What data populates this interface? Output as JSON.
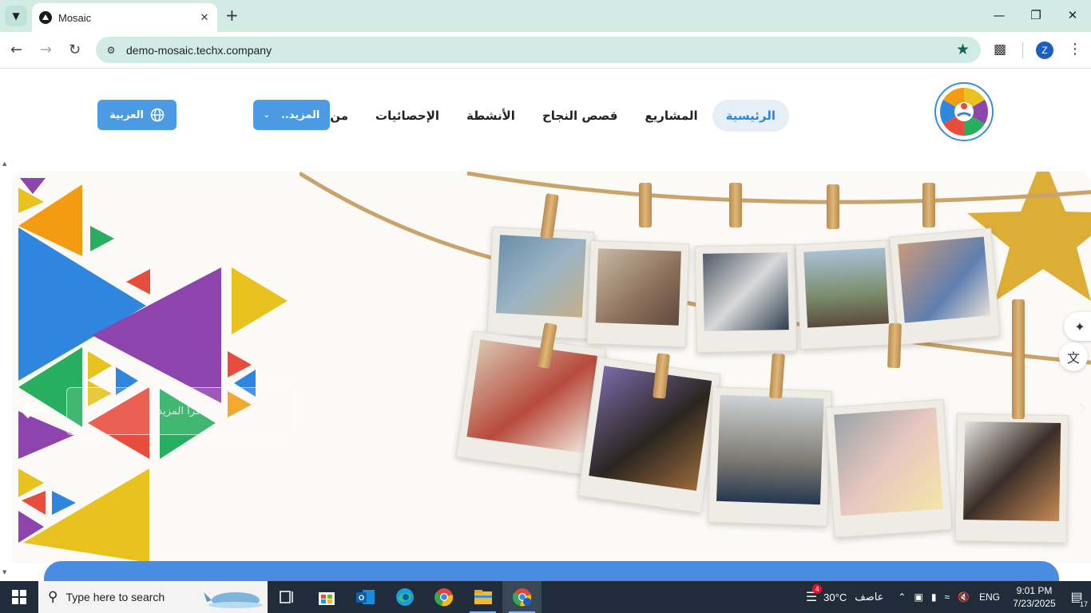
{
  "browser": {
    "tab_title": "Mosaic",
    "url": "demo-mosaic.techx.company",
    "profile_initial": "Z"
  },
  "site": {
    "nav": [
      {
        "label": "الرئيسية",
        "active": true
      },
      {
        "label": "المشاريع",
        "active": false
      },
      {
        "label": "قصص النجاح",
        "active": false
      },
      {
        "label": "الأنشطة",
        "active": false
      },
      {
        "label": "الإحصائيات",
        "active": false
      },
      {
        "label": "من نحن",
        "active": false
      }
    ],
    "more_label": "المزيد..",
    "lang_label": "العربية"
  },
  "hero": {
    "ghost_button_label": "اقرأ المزيد"
  },
  "taskbar": {
    "search_placeholder": "Type here to search",
    "temperature": "30°C",
    "weather": "عاصف",
    "weather_badge": "4",
    "language": "ENG",
    "time": "9:01 PM",
    "date": "7/23/2025",
    "notifications": "17"
  },
  "colors": {
    "accent": "#4a9be4",
    "chrome": "#d3ebe5",
    "taskbar": "#202c3a"
  }
}
